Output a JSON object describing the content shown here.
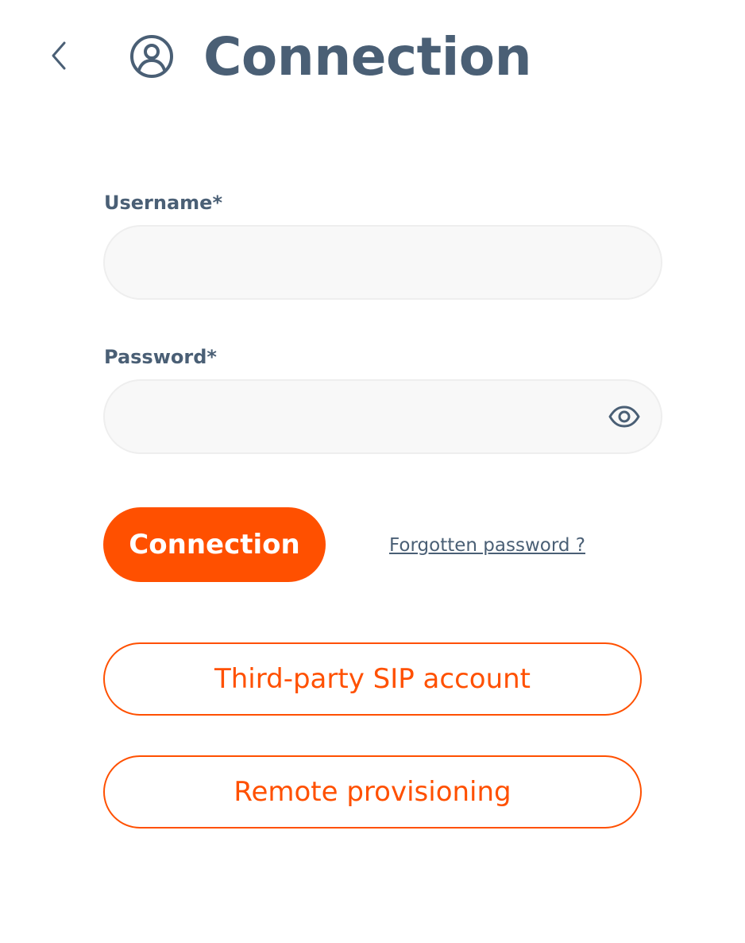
{
  "header": {
    "title": "Connection",
    "back_icon": "chevron-left-icon",
    "user_icon": "user-circle-icon"
  },
  "form": {
    "username_label": "Username*",
    "username_value": "",
    "password_label": "Password*",
    "password_value": "",
    "password_toggle_icon": "eye-icon"
  },
  "actions": {
    "connect_label": "Connection",
    "forgot_label": "Forgotten password ?",
    "third_party_label": "Third-party SIP account",
    "remote_provisioning_label": "Remote provisioning"
  },
  "colors": {
    "accent": "#ff5000",
    "text": "#4a5f75",
    "input_bg": "#f8f8f8"
  }
}
